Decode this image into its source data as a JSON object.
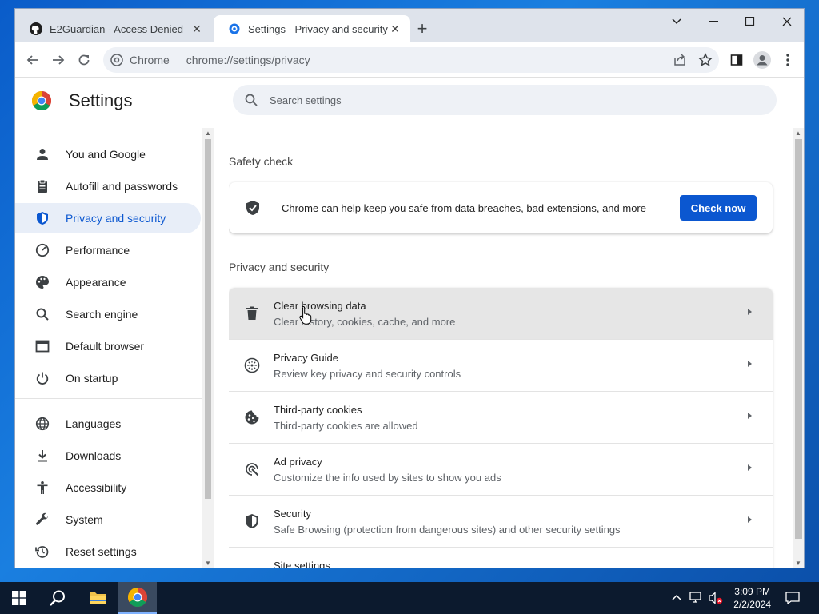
{
  "browser": {
    "tabs": [
      {
        "title": "E2Guardian - Access Denied",
        "icon": "github-icon",
        "active": false
      },
      {
        "title": "Settings - Privacy and security",
        "icon": "gear-icon",
        "active": true
      }
    ],
    "omnibox": {
      "chip": "Chrome",
      "url": "chrome://settings/privacy"
    }
  },
  "settings": {
    "title": "Settings",
    "search_placeholder": "Search settings",
    "nav": [
      {
        "label": "You and Google",
        "icon": "person-icon"
      },
      {
        "label": "Autofill and passwords",
        "icon": "clipboard-icon"
      },
      {
        "label": "Privacy and security",
        "icon": "shield-icon",
        "selected": true
      },
      {
        "label": "Performance",
        "icon": "speedometer-icon"
      },
      {
        "label": "Appearance",
        "icon": "palette-icon"
      },
      {
        "label": "Search engine",
        "icon": "search-icon"
      },
      {
        "label": "Default browser",
        "icon": "browser-icon"
      },
      {
        "label": "On startup",
        "icon": "power-icon"
      },
      {
        "label": "Languages",
        "icon": "globe-icon"
      },
      {
        "label": "Downloads",
        "icon": "download-icon"
      },
      {
        "label": "Accessibility",
        "icon": "accessibility-icon"
      },
      {
        "label": "System",
        "icon": "wrench-icon"
      },
      {
        "label": "Reset settings",
        "icon": "history-icon"
      }
    ],
    "safety_check": {
      "section_title": "Safety check",
      "text": "Chrome can help keep you safe from data breaches, bad extensions, and more",
      "button": "Check now"
    },
    "privacy": {
      "section_title": "Privacy and security",
      "rows": [
        {
          "title": "Clear browsing data",
          "subtitle": "Clear history, cookies, cache, and more",
          "icon": "trash-icon"
        },
        {
          "title": "Privacy Guide",
          "subtitle": "Review key privacy and security controls",
          "icon": "compass-icon"
        },
        {
          "title": "Third-party cookies",
          "subtitle": "Third-party cookies are allowed",
          "icon": "cookie-icon"
        },
        {
          "title": "Ad privacy",
          "subtitle": "Customize the info used by sites to show you ads",
          "icon": "ad-privacy-icon"
        },
        {
          "title": "Security",
          "subtitle": "Safe Browsing (protection from dangerous sites) and other security settings",
          "icon": "shield-icon"
        },
        {
          "title": "Site settings",
          "subtitle": "",
          "icon": "sliders-icon"
        }
      ]
    }
  },
  "taskbar": {
    "time": "3:09 PM",
    "date": "2/2/2024"
  },
  "colors": {
    "accent": "#0b57d0",
    "selected_nav_bg": "#e8eef8",
    "taskbar": "#0c1a2e"
  }
}
